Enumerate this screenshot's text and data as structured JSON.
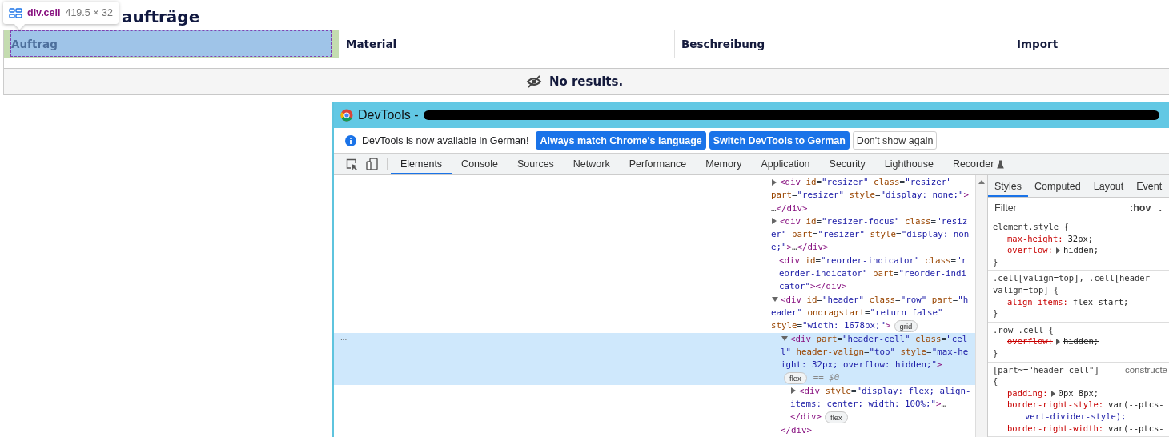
{
  "inspect_tooltip": {
    "element": "div.cell",
    "size": "419.5 × 32"
  },
  "page": {
    "title": "aufträge",
    "columns": [
      {
        "label": "Auftrag",
        "inspected": true
      },
      {
        "label": "Material",
        "inspected": false
      },
      {
        "label": "Beschreibung",
        "inspected": false
      },
      {
        "label": "Import",
        "inspected": false
      }
    ],
    "empty_message": "No results."
  },
  "devtools": {
    "title": "DevTools -",
    "infobar": {
      "message": "DevTools is now available in German!",
      "buttons": [
        {
          "label": "Always match Chrome's language",
          "kind": "primary"
        },
        {
          "label": "Switch DevTools to German",
          "kind": "primary"
        },
        {
          "label": "Don't show again",
          "kind": "secondary"
        }
      ]
    },
    "tabs": [
      {
        "label": "Elements",
        "selected": true,
        "experimental": false
      },
      {
        "label": "Console",
        "selected": false,
        "experimental": false
      },
      {
        "label": "Sources",
        "selected": false,
        "experimental": false
      },
      {
        "label": "Network",
        "selected": false,
        "experimental": false
      },
      {
        "label": "Performance",
        "selected": false,
        "experimental": false
      },
      {
        "label": "Memory",
        "selected": false,
        "experimental": false
      },
      {
        "label": "Application",
        "selected": false,
        "experimental": false
      },
      {
        "label": "Security",
        "selected": false,
        "experimental": false
      },
      {
        "label": "Lighthouse",
        "selected": false,
        "experimental": false
      },
      {
        "label": "Recorder",
        "selected": false,
        "experimental": true
      }
    ],
    "dom_tree": [
      {
        "kind": "branch",
        "expanded": false,
        "selected": false,
        "lines": [
          {
            "code": "<div id=\"resizer\" class=\"resizer\""
          },
          {
            "code": "part=\"resizer\" style=\"display: none;\">"
          },
          {
            "code": "…</div>"
          }
        ]
      },
      {
        "kind": "branch",
        "expanded": false,
        "selected": false,
        "lines": [
          {
            "code": "<div id=\"resizer-focus\" class=\"resiz"
          },
          {
            "code": "er\" part=\"resizer\" style=\"display: non"
          },
          {
            "code": "e;\">…</div>"
          }
        ]
      },
      {
        "kind": "leaf",
        "selected": false,
        "lines": [
          {
            "code": "<div id=\"reorder-indicator\" class=\"r"
          },
          {
            "code": "eorder-indicator\" part=\"reorder-indi"
          },
          {
            "code": "cator\"></div>"
          }
        ]
      },
      {
        "kind": "branch",
        "expanded": true,
        "selected": false,
        "lines": [
          {
            "code": "<div id=\"header\" class=\"row\" part=\"h"
          },
          {
            "code": "eader\" ondragstart=\"return false\""
          },
          {
            "code": "style=\"width: 1678px;\">",
            "badge": "grid"
          }
        ],
        "children": [
          {
            "kind": "branch",
            "expanded": true,
            "selected": true,
            "marker": "...",
            "lines": [
              {
                "code": "<div part=\"header-cell\" class=\"cel"
              },
              {
                "code": "l\" header-valign=\"top\" style=\"max-he"
              },
              {
                "code": "ight: 32px; overflow: hidden;\">"
              },
              {
                "badge": "flex",
                "note": "== $0"
              }
            ],
            "children": [
              {
                "kind": "branch",
                "expanded": false,
                "selected": false,
                "lines": [
                  {
                    "code": "<div style=\"display: flex; align-"
                  },
                  {
                    "code": "items: center; width: 100%;\">…"
                  },
                  {
                    "code": "</div>",
                    "badge": "flex"
                  }
                ]
              }
            ],
            "closing": [
              {
                "code": "</div>"
              }
            ]
          }
        ]
      }
    ],
    "sidebar_tabs": [
      {
        "label": "Styles",
        "selected": true
      },
      {
        "label": "Computed",
        "selected": false
      },
      {
        "label": "Layout",
        "selected": false
      },
      {
        "label": "Event",
        "selected": false
      }
    ],
    "filter": {
      "placeholder": "Filter"
    },
    "filter_buttons": [
      ":hov",
      "."
    ],
    "rules": [
      {
        "selector_lines": [
          "element.style {"
        ],
        "props": [
          {
            "name": "max-height:",
            "value_lines": [
              "32px;"
            ],
            "expander": false,
            "overridden": false
          },
          {
            "name": "overflow:",
            "value_lines": [
              "hidden;"
            ],
            "expander": true,
            "overridden": false
          }
        ],
        "close": "}"
      },
      {
        "selector_lines": [
          ".cell[valign=top], .cell[header-",
          "valign=top] {"
        ],
        "props": [
          {
            "name": "align-items:",
            "value_lines": [
              "flex-start;"
            ],
            "expander": false,
            "overridden": false
          }
        ],
        "close": "}"
      },
      {
        "selector_lines": [
          ".row .cell {"
        ],
        "props": [
          {
            "name": "overflow:",
            "value_lines": [
              "hidden;"
            ],
            "expander": true,
            "overridden": true
          }
        ],
        "close": "}"
      },
      {
        "selector_lines": [
          "[part~=\"header-cell\"]",
          "{"
        ],
        "source": "constructe",
        "props": [
          {
            "name": "padding:",
            "value_lines": [
              "0px 8px;"
            ],
            "expander": true,
            "overridden": false
          },
          {
            "name": "border-right-style:",
            "value_lines": [
              "var(--ptcs-",
              "vert-divider-style);"
            ],
            "expander": false,
            "overridden": false
          },
          {
            "name": "border-right-width:",
            "value_lines": [
              "var(--ptcs-"
            ],
            "expander": false,
            "overridden": false
          }
        ]
      }
    ]
  }
}
